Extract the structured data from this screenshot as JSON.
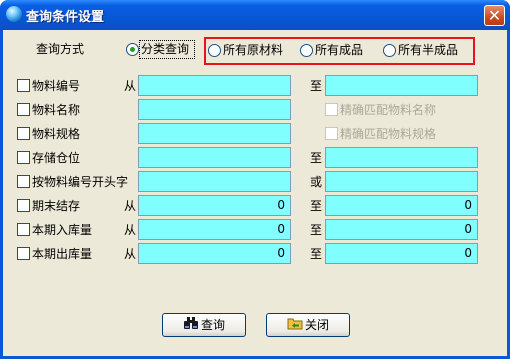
{
  "window": {
    "title": "查询条件设置",
    "close": "✕"
  },
  "query_mode": {
    "label": "查询方式",
    "options": [
      "分类查询",
      "所有原材料",
      "所有成品",
      "所有半成品"
    ],
    "selected": "分类查询",
    "colors": {
      "highlight_box": "#e8131b",
      "radio_dot": "#21a121"
    }
  },
  "rows": [
    {
      "label": "物料编号",
      "from": "从",
      "to": "至",
      "from_value": "",
      "to_value": ""
    },
    {
      "label": "物料名称",
      "from_value": "",
      "option": "精确匹配物料名称"
    },
    {
      "label": "物料规格",
      "from_value": "",
      "option": "精确匹配物料规格"
    },
    {
      "label": "存储仓位",
      "to": "至",
      "from_value": "",
      "to_value": ""
    },
    {
      "label": "按物料编号开头字",
      "to": "或",
      "from_value": "",
      "to_value": ""
    },
    {
      "label": "期末结存",
      "from": "从",
      "to": "至",
      "from_value": "0",
      "to_value": "0"
    },
    {
      "label": "本期入库量",
      "from": "从",
      "to": "至",
      "from_value": "0",
      "to_value": "0"
    },
    {
      "label": "本期出库量",
      "from": "从",
      "to": "至",
      "from_value": "0",
      "to_value": "0"
    }
  ],
  "buttons": {
    "query": "查询",
    "close": "关闭"
  },
  "colors": {
    "field_bg": "#80ffff",
    "dialog_bg": "#ece9d8",
    "titlebar": "#0757d6"
  }
}
